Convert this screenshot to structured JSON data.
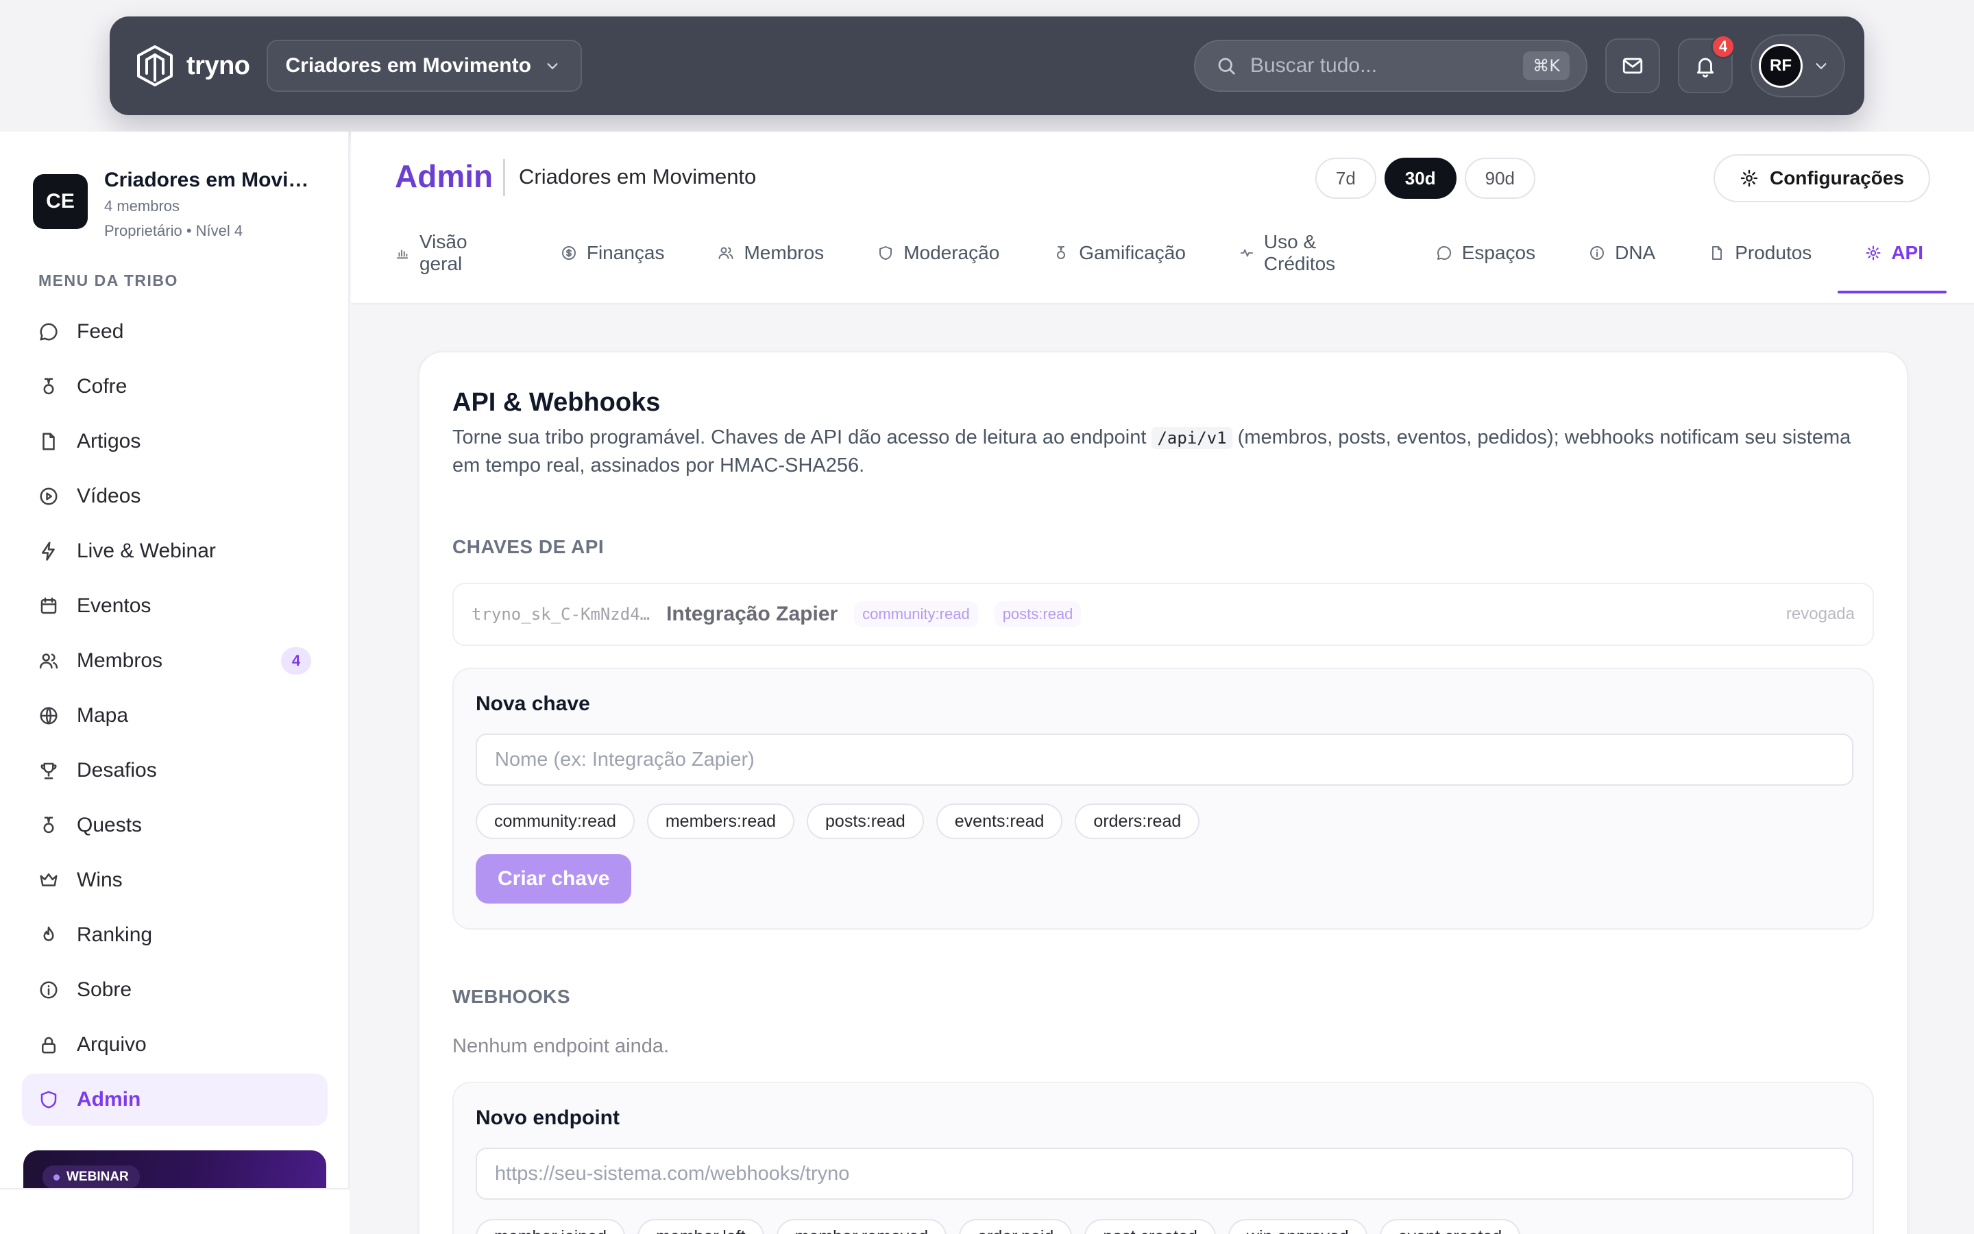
{
  "topbar": {
    "brand_name": "tryno",
    "community_select": "Criadores em Movimento",
    "search_placeholder": "Buscar tudo...",
    "search_shortcut": "⌘K",
    "notification_count": "4",
    "user_initials": "RF"
  },
  "sidebar": {
    "tribe_initials": "CE",
    "tribe_name": "Criadores em Movimento",
    "tribe_members": "4 membros",
    "tribe_role_level": "Proprietário • Nível 4",
    "menu_title": "MENU DA TRIBO",
    "items": [
      {
        "label": "Feed",
        "icon": "chat-bubble-icon"
      },
      {
        "label": "Cofre",
        "icon": "medal-icon"
      },
      {
        "label": "Artigos",
        "icon": "document-icon"
      },
      {
        "label": "Vídeos",
        "icon": "play-circle-icon"
      },
      {
        "label": "Live & Webinar",
        "icon": "bolt-icon"
      },
      {
        "label": "Eventos",
        "icon": "calendar-icon"
      },
      {
        "label": "Membros",
        "icon": "users-icon",
        "badge": "4"
      },
      {
        "label": "Mapa",
        "icon": "globe-icon"
      },
      {
        "label": "Desafios",
        "icon": "trophy-icon"
      },
      {
        "label": "Quests",
        "icon": "medal-icon"
      },
      {
        "label": "Wins",
        "icon": "crown-icon"
      },
      {
        "label": "Ranking",
        "icon": "flame-icon"
      },
      {
        "label": "Sobre",
        "icon": "info-icon"
      },
      {
        "label": "Arquivo",
        "icon": "lock-icon"
      },
      {
        "label": "Admin",
        "icon": "shield-icon",
        "active": true
      }
    ],
    "webinar_badge": "WEBINAR"
  },
  "header": {
    "title": "Admin",
    "subtitle": "Criadores em Movimento",
    "ranges": [
      "7d",
      "30d",
      "90d"
    ],
    "active_range": "30d",
    "config_label": "Configurações",
    "tabs": [
      {
        "label": "Visão geral",
        "icon": "bar-chart-icon"
      },
      {
        "label": "Finanças",
        "icon": "coin-icon"
      },
      {
        "label": "Membros",
        "icon": "users-icon"
      },
      {
        "label": "Moderação",
        "icon": "shield-icon"
      },
      {
        "label": "Gamificação",
        "icon": "medal-icon"
      },
      {
        "label": "Uso & Créditos",
        "icon": "activity-icon"
      },
      {
        "label": "Espaços",
        "icon": "chat-bubble-icon"
      },
      {
        "label": "DNA",
        "icon": "info-icon"
      },
      {
        "label": "Produtos",
        "icon": "document-icon"
      },
      {
        "label": "API",
        "icon": "gear-icon",
        "active": true
      }
    ]
  },
  "card": {
    "title": "API & Webhooks",
    "desc_before": "Torne sua tribo programável. Chaves de API dão acesso de leitura ao endpoint ",
    "desc_code": "/api/v1",
    "desc_after": " (membros, posts, eventos, pedidos); webhooks notificam seu sistema em tempo real, assinados por HMAC-SHA256.",
    "keys_section": "CHAVES DE API",
    "existing_key": {
      "prefix": "tryno_sk_C-KmNzd4…",
      "name": "Integração Zapier",
      "scopes": [
        "community:read",
        "posts:read"
      ],
      "status": "revogada"
    },
    "new_key": {
      "title": "Nova chave",
      "name_placeholder": "Nome (ex: Integração Zapier)",
      "scopes": [
        "community:read",
        "members:read",
        "posts:read",
        "events:read",
        "orders:read"
      ],
      "create_label": "Criar chave"
    },
    "webhooks_section": "WEBHOOKS",
    "webhooks_empty": "Nenhum endpoint ainda.",
    "new_endpoint": {
      "title": "Novo endpoint",
      "url_placeholder": "https://seu-sistema.com/webhooks/tryno",
      "events": [
        "member.joined",
        "member.left",
        "member.removed",
        "order.paid",
        "post.created",
        "win.approved",
        "event.created"
      ]
    }
  },
  "colors": {
    "accent": "#7c3aed",
    "topbar": "#414652",
    "notification": "#ef4444"
  }
}
